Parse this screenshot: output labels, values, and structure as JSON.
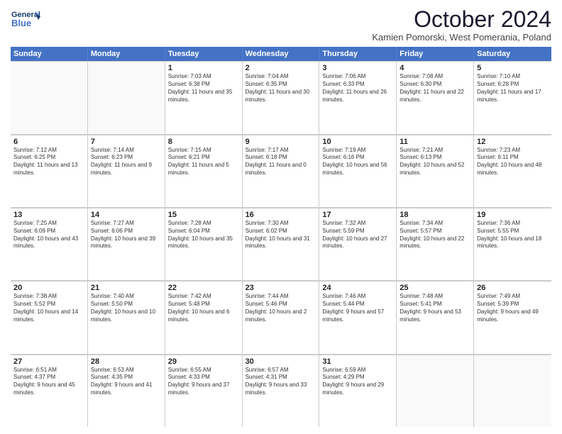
{
  "logo": {
    "line1": "General",
    "line2": "Blue"
  },
  "title": "October 2024",
  "subtitle": "Kamien Pomorski, West Pomerania, Poland",
  "days_of_week": [
    "Sunday",
    "Monday",
    "Tuesday",
    "Wednesday",
    "Thursday",
    "Friday",
    "Saturday"
  ],
  "weeks": [
    [
      {
        "day": "",
        "info": ""
      },
      {
        "day": "",
        "info": ""
      },
      {
        "day": "1",
        "info": "Sunrise: 7:03 AM\nSunset: 6:38 PM\nDaylight: 11 hours and 35 minutes."
      },
      {
        "day": "2",
        "info": "Sunrise: 7:04 AM\nSunset: 6:35 PM\nDaylight: 11 hours and 30 minutes."
      },
      {
        "day": "3",
        "info": "Sunrise: 7:06 AM\nSunset: 6:33 PM\nDaylight: 11 hours and 26 minutes."
      },
      {
        "day": "4",
        "info": "Sunrise: 7:08 AM\nSunset: 6:30 PM\nDaylight: 11 hours and 22 minutes."
      },
      {
        "day": "5",
        "info": "Sunrise: 7:10 AM\nSunset: 6:28 PM\nDaylight: 11 hours and 17 minutes."
      }
    ],
    [
      {
        "day": "6",
        "info": "Sunrise: 7:12 AM\nSunset: 6:25 PM\nDaylight: 11 hours and 13 minutes."
      },
      {
        "day": "7",
        "info": "Sunrise: 7:14 AM\nSunset: 6:23 PM\nDaylight: 11 hours and 9 minutes."
      },
      {
        "day": "8",
        "info": "Sunrise: 7:15 AM\nSunset: 6:21 PM\nDaylight: 11 hours and 5 minutes."
      },
      {
        "day": "9",
        "info": "Sunrise: 7:17 AM\nSunset: 6:18 PM\nDaylight: 11 hours and 0 minutes."
      },
      {
        "day": "10",
        "info": "Sunrise: 7:19 AM\nSunset: 6:16 PM\nDaylight: 10 hours and 56 minutes."
      },
      {
        "day": "11",
        "info": "Sunrise: 7:21 AM\nSunset: 6:13 PM\nDaylight: 10 hours and 52 minutes."
      },
      {
        "day": "12",
        "info": "Sunrise: 7:23 AM\nSunset: 6:11 PM\nDaylight: 10 hours and 48 minutes."
      }
    ],
    [
      {
        "day": "13",
        "info": "Sunrise: 7:25 AM\nSunset: 6:09 PM\nDaylight: 10 hours and 43 minutes."
      },
      {
        "day": "14",
        "info": "Sunrise: 7:27 AM\nSunset: 6:06 PM\nDaylight: 10 hours and 39 minutes."
      },
      {
        "day": "15",
        "info": "Sunrise: 7:28 AM\nSunset: 6:04 PM\nDaylight: 10 hours and 35 minutes."
      },
      {
        "day": "16",
        "info": "Sunrise: 7:30 AM\nSunset: 6:02 PM\nDaylight: 10 hours and 31 minutes."
      },
      {
        "day": "17",
        "info": "Sunrise: 7:32 AM\nSunset: 5:59 PM\nDaylight: 10 hours and 27 minutes."
      },
      {
        "day": "18",
        "info": "Sunrise: 7:34 AM\nSunset: 5:57 PM\nDaylight: 10 hours and 22 minutes."
      },
      {
        "day": "19",
        "info": "Sunrise: 7:36 AM\nSunset: 5:55 PM\nDaylight: 10 hours and 18 minutes."
      }
    ],
    [
      {
        "day": "20",
        "info": "Sunrise: 7:38 AM\nSunset: 5:52 PM\nDaylight: 10 hours and 14 minutes."
      },
      {
        "day": "21",
        "info": "Sunrise: 7:40 AM\nSunset: 5:50 PM\nDaylight: 10 hours and 10 minutes."
      },
      {
        "day": "22",
        "info": "Sunrise: 7:42 AM\nSunset: 5:48 PM\nDaylight: 10 hours and 6 minutes."
      },
      {
        "day": "23",
        "info": "Sunrise: 7:44 AM\nSunset: 5:46 PM\nDaylight: 10 hours and 2 minutes."
      },
      {
        "day": "24",
        "info": "Sunrise: 7:46 AM\nSunset: 5:44 PM\nDaylight: 9 hours and 57 minutes."
      },
      {
        "day": "25",
        "info": "Sunrise: 7:48 AM\nSunset: 5:41 PM\nDaylight: 9 hours and 53 minutes."
      },
      {
        "day": "26",
        "info": "Sunrise: 7:49 AM\nSunset: 5:39 PM\nDaylight: 9 hours and 49 minutes."
      }
    ],
    [
      {
        "day": "27",
        "info": "Sunrise: 6:51 AM\nSunset: 4:37 PM\nDaylight: 9 hours and 45 minutes."
      },
      {
        "day": "28",
        "info": "Sunrise: 6:53 AM\nSunset: 4:35 PM\nDaylight: 9 hours and 41 minutes."
      },
      {
        "day": "29",
        "info": "Sunrise: 6:55 AM\nSunset: 4:33 PM\nDaylight: 9 hours and 37 minutes."
      },
      {
        "day": "30",
        "info": "Sunrise: 6:57 AM\nSunset: 4:31 PM\nDaylight: 9 hours and 33 minutes."
      },
      {
        "day": "31",
        "info": "Sunrise: 6:59 AM\nSunset: 4:29 PM\nDaylight: 9 hours and 29 minutes."
      },
      {
        "day": "",
        "info": ""
      },
      {
        "day": "",
        "info": ""
      }
    ]
  ]
}
